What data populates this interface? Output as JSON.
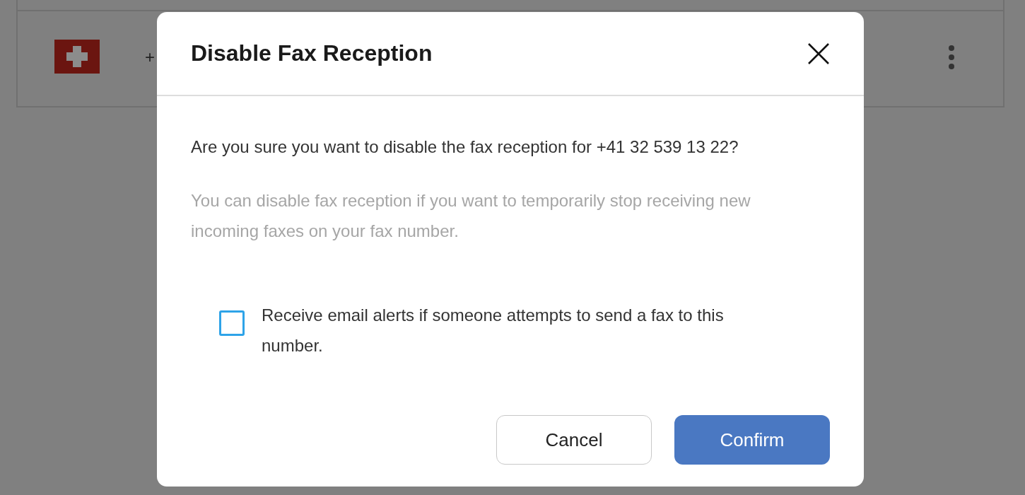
{
  "background_row": {
    "phone_number": "+"
  },
  "dialog": {
    "title": "Disable Fax Reception",
    "message": "Are you sure you want to disable the fax reception for +41 32 539 13 22?",
    "note": "You can disable fax reception if you want to temporarily stop receiving new incoming faxes on your fax number.",
    "checkbox": {
      "label": "Receive email alerts if someone attempts to send a fax to this number.",
      "checked": false
    },
    "buttons": [
      {
        "label": "Cancel",
        "kind": "secondary"
      },
      {
        "label": "Confirm",
        "kind": "primary"
      }
    ]
  }
}
